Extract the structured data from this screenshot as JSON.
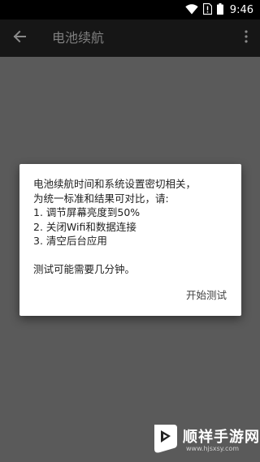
{
  "status_bar": {
    "time": "9:46",
    "icons": [
      "wifi-icon",
      "sim-no-service-icon",
      "battery-icon"
    ],
    "background": "#000000"
  },
  "app_bar": {
    "title": "电池续航",
    "back_icon": "arrow-back-icon",
    "menu_icon": "overflow-menu-icon",
    "background": "#161616"
  },
  "dialog": {
    "lines": [
      "电池续航时间和系统设置密切相关，",
      "为统一标准和结果可对比，请:",
      "1. 调节屏幕亮度到50%",
      "2. 关闭Wifi和数据连接",
      "3. 清空后台应用",
      "测试可能需要几分钟。"
    ],
    "action_label": "开始测试"
  },
  "watermark": {
    "text": "顺祥手游网",
    "url": "www.hjsxsy.com"
  },
  "colors": {
    "scrim_background": "#5a5a5a",
    "dialog_background": "#ffffff",
    "title_text": "#7f7f7f"
  }
}
